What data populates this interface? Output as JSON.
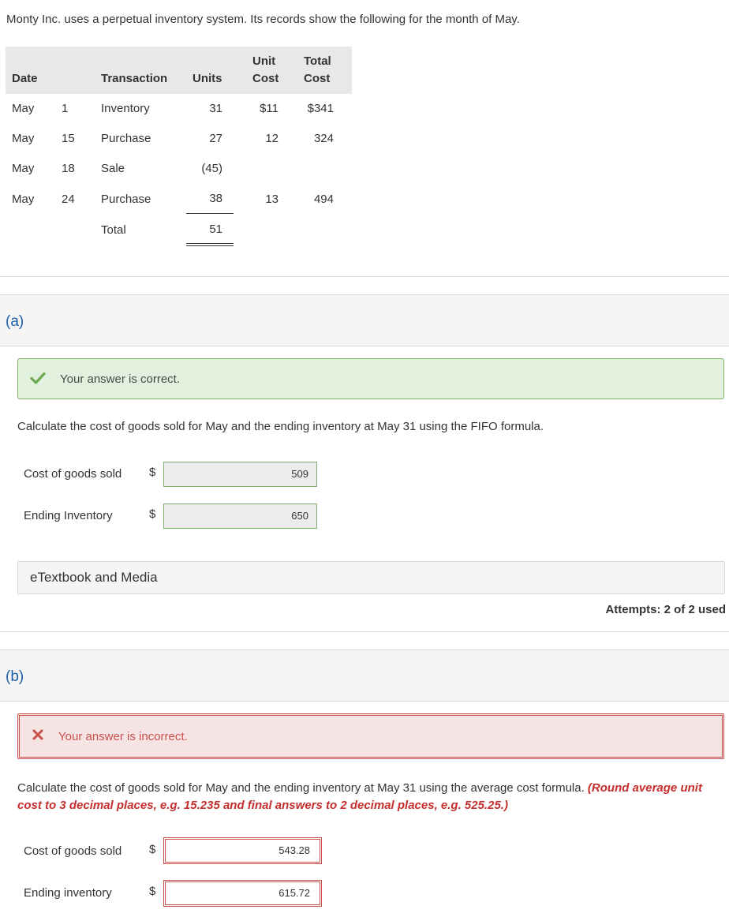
{
  "intro": "Monty Inc. uses a perpetual inventory system. Its records show the following for the month of May.",
  "table": {
    "headers": {
      "date": "Date",
      "transaction": "Transaction",
      "units": "Units",
      "unit_cost_1": "Unit",
      "unit_cost_2": "Cost",
      "total_cost_1": "Total",
      "total_cost_2": "Cost"
    },
    "rows": [
      {
        "month": "May",
        "day": "1",
        "transaction": "Inventory",
        "units": "31",
        "unit_cost": "$11",
        "total_cost": "$341"
      },
      {
        "month": "May",
        "day": "15",
        "transaction": "Purchase",
        "units": "27",
        "unit_cost": "12",
        "total_cost": "324"
      },
      {
        "month": "May",
        "day": "18",
        "transaction": "Sale",
        "units": "(45)",
        "unit_cost": "",
        "total_cost": ""
      },
      {
        "month": "May",
        "day": "24",
        "transaction": "Purchase",
        "units": "38",
        "unit_cost": "13",
        "total_cost": "494"
      }
    ],
    "total": {
      "label": "Total",
      "units": "51"
    }
  },
  "part_a": {
    "label": "(a)",
    "status": "Your answer is correct.",
    "question": "Calculate the cost of goods sold for May and the ending inventory at May 31 using the FIFO formula.",
    "cogs_label": "Cost of goods sold",
    "cogs_value": "509",
    "ending_label": "Ending Inventory",
    "ending_value": "650",
    "currency": "$",
    "etextbook": "eTextbook and Media",
    "attempts": "Attempts: 2 of 2 used"
  },
  "part_b": {
    "label": "(b)",
    "status": "Your answer is incorrect.",
    "question": "Calculate the cost of goods sold for May and the ending inventory at May 31 using the average cost formula.",
    "hint": "(Round average unit cost to 3 decimal places, e.g. 15.235 and final answers to 2 decimal places, e.g. 525.25.)",
    "cogs_label": "Cost of goods sold",
    "cogs_value": "543.28",
    "ending_label": "Ending inventory",
    "ending_value": "615.72",
    "currency": "$"
  },
  "colors": {
    "correct_green": "#6aaa4f",
    "incorrect_red": "#c9504b",
    "part_label_blue": "#1a5fa8"
  },
  "icons": {
    "correct": "check-icon",
    "incorrect": "x-icon"
  }
}
